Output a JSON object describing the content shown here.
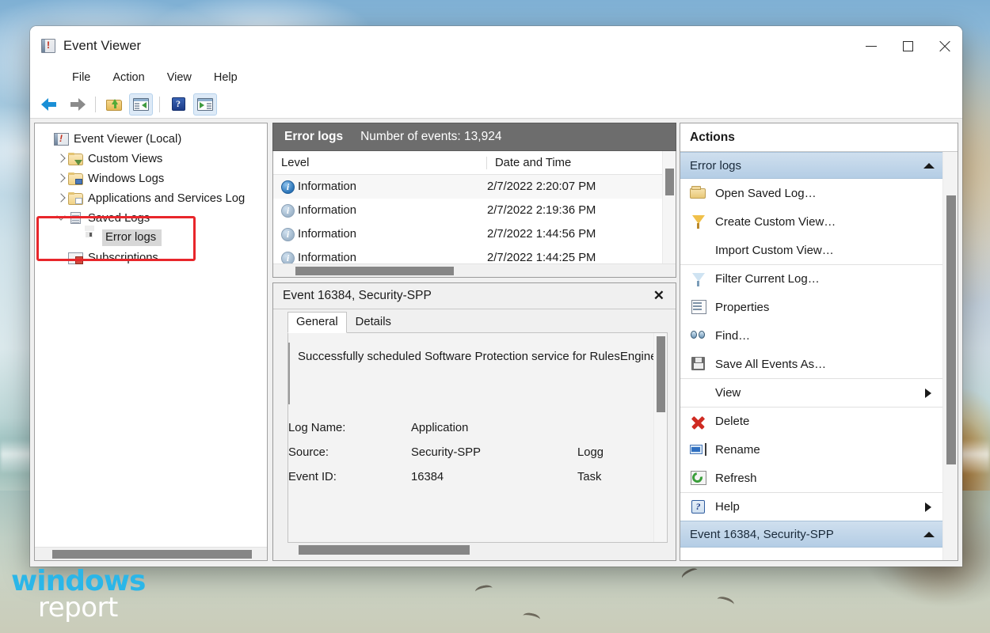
{
  "window": {
    "title": "Event Viewer",
    "icon": "event-viewer-icon",
    "controls": {
      "minimize": "—",
      "maximize": "□",
      "close": "✕"
    }
  },
  "menubar": {
    "items": [
      "File",
      "Action",
      "View",
      "Help"
    ]
  },
  "toolbar": {
    "buttons": [
      {
        "name": "back-arrow-icon",
        "label": "Back"
      },
      {
        "name": "forward-arrow-icon",
        "label": "Forward"
      },
      {
        "name": "open-folder-icon",
        "label": "Open Saved Log"
      },
      {
        "name": "show-hide-console-tree-icon",
        "label": "Show/Hide Console Tree"
      },
      {
        "name": "help-icon",
        "label": "Help"
      },
      {
        "name": "show-hide-action-pane-icon",
        "label": "Show/Hide Action Pane"
      }
    ]
  },
  "sidebar": {
    "items": [
      {
        "label": "Event Viewer (Local)",
        "icon": "event-viewer-icon",
        "indent": 0,
        "expander": "none",
        "selected": false
      },
      {
        "label": "Custom Views",
        "icon": "folder-funnel-icon",
        "indent": 1,
        "expander": "collapsed",
        "selected": false
      },
      {
        "label": "Windows Logs",
        "icon": "folder-monitor-icon",
        "indent": 1,
        "expander": "collapsed",
        "selected": false
      },
      {
        "label": "Applications and Services Log",
        "icon": "folder-window-icon",
        "indent": 1,
        "expander": "collapsed",
        "selected": false
      },
      {
        "label": "Saved Logs",
        "icon": "folder-stack-icon",
        "indent": 1,
        "expander": "expanded",
        "selected": false
      },
      {
        "label": "Error logs",
        "icon": "floppy-disk-icon",
        "indent": 2,
        "expander": "none",
        "selected": true
      },
      {
        "label": "Subscriptions",
        "icon": "folder-subscription-icon",
        "indent": 1,
        "expander": "none",
        "selected": false
      }
    ],
    "highlight_color": "#e8262b"
  },
  "center": {
    "header": {
      "log_name": "Error logs",
      "count_label": "Number of events: 13,924"
    },
    "columns": [
      "Level",
      "Date and Time"
    ],
    "rows": [
      {
        "level": "Information",
        "date": "2/7/2022 2:20:07 PM"
      },
      {
        "level": "Information",
        "date": "2/7/2022 2:19:36 PM"
      },
      {
        "level": "Information",
        "date": "2/7/2022 1:44:56 PM"
      },
      {
        "level": "Information",
        "date": "2/7/2022 1:44:25 PM"
      }
    ]
  },
  "detail": {
    "title": "Event 16384, Security-SPP",
    "close_label": "✕",
    "tabs": [
      {
        "label": "General",
        "active": true
      },
      {
        "label": "Details",
        "active": false
      }
    ],
    "message": "Successfully scheduled Software Protection service for RulesEngine.",
    "fields": [
      {
        "label": "Log Name:",
        "value": "Application",
        "right": ""
      },
      {
        "label": "Source:",
        "value": "Security-SPP",
        "right": "Logg"
      },
      {
        "label": "Event ID:",
        "value": "16384",
        "right": "Task"
      }
    ]
  },
  "actions": {
    "title": "Actions",
    "groups": [
      {
        "label": "Error logs",
        "collapse_icon": "caret-up-icon",
        "items": [
          {
            "label": "Open Saved Log…",
            "icon": "open-folder-icon",
            "submenu": false,
            "separator": false
          },
          {
            "label": "Create Custom View…",
            "icon": "funnel-yellow-icon",
            "submenu": false,
            "separator": false
          },
          {
            "label": "Import Custom View…",
            "icon": "none",
            "submenu": false,
            "separator": false
          },
          {
            "label": "Filter Current Log…",
            "icon": "funnel-blue-icon",
            "submenu": false,
            "separator": true
          },
          {
            "label": "Properties",
            "icon": "properties-icon",
            "submenu": false,
            "separator": false
          },
          {
            "label": "Find…",
            "icon": "binoculars-icon",
            "submenu": false,
            "separator": false
          },
          {
            "label": "Save All Events As…",
            "icon": "floppy-disk-icon",
            "submenu": false,
            "separator": false
          },
          {
            "label": "View",
            "icon": "none",
            "submenu": true,
            "separator": true
          },
          {
            "label": "Delete",
            "icon": "delete-x-icon",
            "submenu": false,
            "separator": true
          },
          {
            "label": "Rename",
            "icon": "rename-icon",
            "submenu": false,
            "separator": false
          },
          {
            "label": "Refresh",
            "icon": "refresh-icon",
            "submenu": false,
            "separator": false
          },
          {
            "label": "Help",
            "icon": "help-icon",
            "submenu": true,
            "separator": true
          }
        ]
      }
    ],
    "footer_group": {
      "label": "Event 16384, Security-SPP",
      "collapse_icon": "caret-up-icon"
    }
  },
  "watermark": {
    "line1": "windows",
    "line2": "report",
    "color1": "#2bb6e8",
    "color2": "#ffffff"
  }
}
